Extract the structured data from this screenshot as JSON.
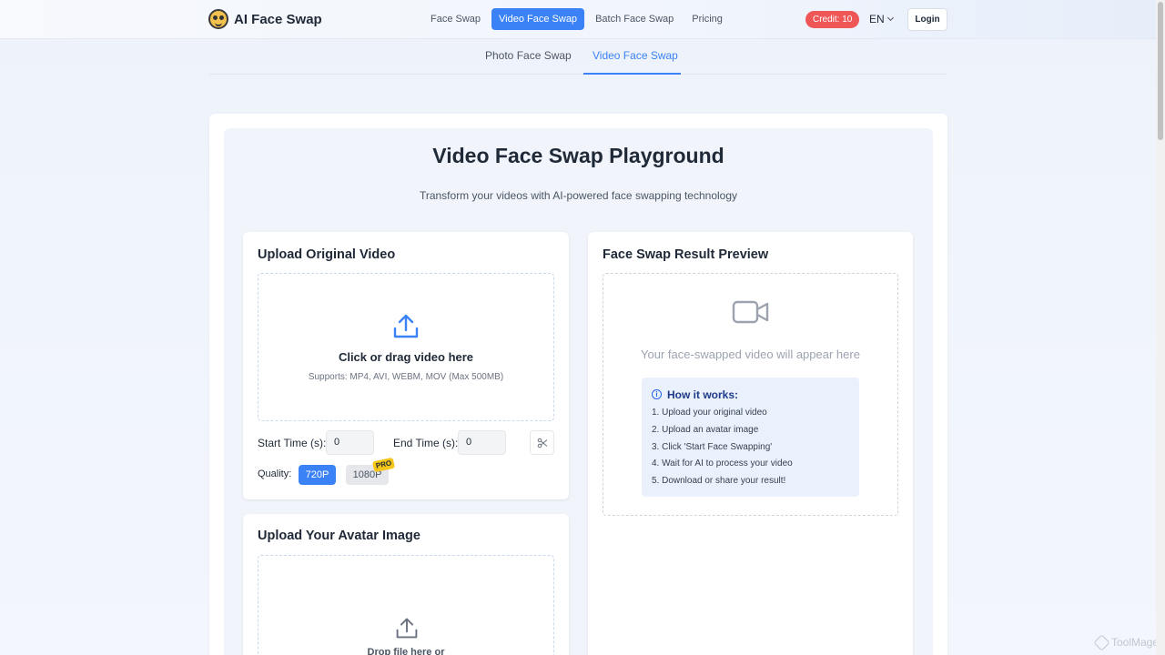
{
  "header": {
    "logo_text": "AI Face Swap",
    "nav": [
      "Face Swap",
      "Video Face Swap",
      "Batch Face Swap",
      "Pricing"
    ],
    "active_nav": "Video Face Swap",
    "credit": "Credit: 10",
    "language": "EN",
    "login": "Login"
  },
  "subtabs": [
    "Photo Face Swap",
    "Video Face Swap"
  ],
  "active_subtab": "Video Face Swap",
  "main": {
    "title": "Video Face Swap Playground",
    "subtitle": "Transform your videos with AI-powered face swapping technology"
  },
  "upload_video": {
    "title": "Upload Original Video",
    "drop_text": "Click or drag video here",
    "supports": "Supports: MP4, AVI, WEBM, MOV (Max 500MB)",
    "start_label": "Start Time (s):",
    "start_value": "0",
    "end_label": "End Time (s):",
    "end_value": "0",
    "quality_label": "Quality:",
    "quality_options": [
      "720P",
      "1080P"
    ],
    "selected_quality": "720P",
    "pro_badge": "PRO"
  },
  "avatar": {
    "title": "Upload Your Avatar Image",
    "drop_text": "Drop file here or"
  },
  "preview": {
    "title": "Face Swap Result Preview",
    "placeholder": "Your face-swapped video will appear here",
    "how_title": "How it works:",
    "steps": [
      "1. Upload your original video",
      "2. Upload an avatar image",
      "3. Click 'Start Face Swapping'",
      "4. Wait for AI to process your video",
      "5. Download or share your result!"
    ]
  },
  "watermark": "ToolMage",
  "colors": {
    "accent": "#3b82f6",
    "credit": "#ef5757",
    "pro": "#f5c518"
  }
}
